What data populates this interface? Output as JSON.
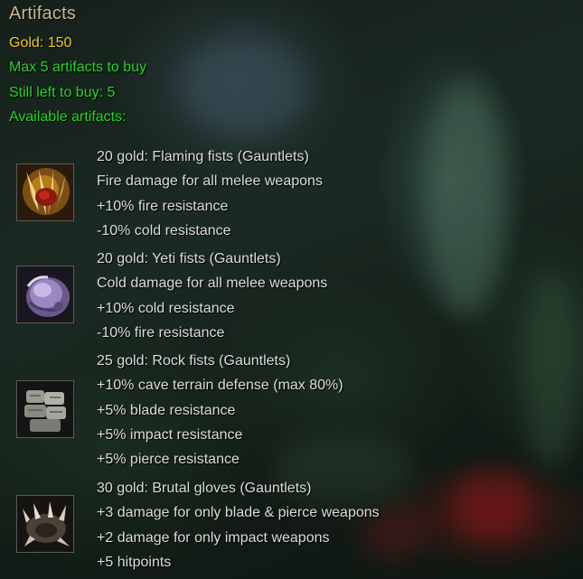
{
  "dialog": {
    "title": "Artifacts",
    "gold_line": "Gold: 150",
    "max_line": "Max 5 artifacts to buy",
    "left_line": "Still left to buy: 5",
    "available_line": "Available artifacts:"
  },
  "colors": {
    "title": "#c9b78f",
    "gold": "#f0c828",
    "green": "#28d228",
    "item_text": "#dcdcdc"
  },
  "artifacts": [
    {
      "icon": "flaming-fists-icon",
      "lines": [
        "20 gold: Flaming fists (Gauntlets)",
        "Fire damage for all melee weapons",
        "+10% fire resistance",
        "-10% cold resistance"
      ]
    },
    {
      "icon": "yeti-fists-icon",
      "lines": [
        "20 gold: Yeti fists (Gauntlets)",
        "Cold damage for all melee weapons",
        "+10% cold resistance",
        "-10% fire resistance"
      ]
    },
    {
      "icon": "rock-fists-icon",
      "lines": [
        "25 gold: Rock fists (Gauntlets)",
        "+10% cave terrain defense (max 80%)",
        "+5% blade resistance",
        "+5% impact resistance",
        "+5% pierce resistance"
      ]
    },
    {
      "icon": "brutal-gloves-icon",
      "lines": [
        "30 gold: Brutal gloves (Gauntlets)",
        "+3 damage for only blade & pierce weapons",
        "+2 damage for only impact weapons",
        "+5 hitpoints"
      ]
    }
  ]
}
